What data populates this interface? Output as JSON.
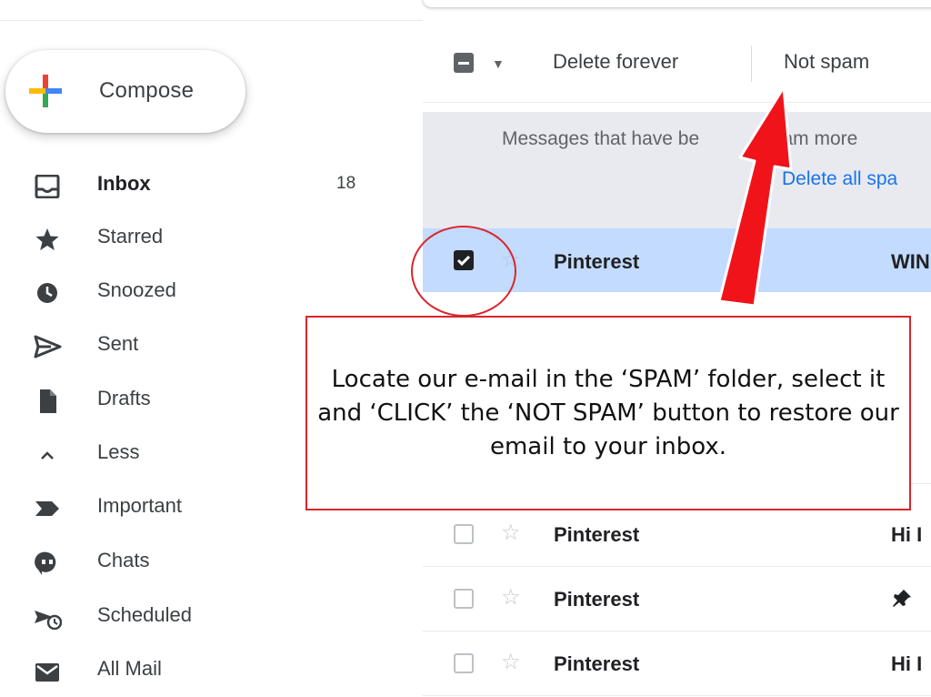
{
  "compose": {
    "label": "Compose",
    "icon": "compose-plus-icon"
  },
  "sidebar": {
    "items": [
      {
        "label": "Inbox",
        "count": "18",
        "icon": "inbox-icon",
        "active": true
      },
      {
        "label": "Starred",
        "count": "",
        "icon": "star-icon"
      },
      {
        "label": "Snoozed",
        "count": "",
        "icon": "clock-icon"
      },
      {
        "label": "Sent",
        "count": "",
        "icon": "send-icon"
      },
      {
        "label": "Drafts",
        "count": "",
        "icon": "draft-icon"
      },
      {
        "label": "Less",
        "count": "",
        "icon": "chevron-up-icon"
      },
      {
        "label": "Important",
        "count": "",
        "icon": "important-icon"
      },
      {
        "label": "Chats",
        "count": "",
        "icon": "chat-icon"
      },
      {
        "label": "Scheduled",
        "count": "",
        "icon": "scheduled-icon"
      },
      {
        "label": "All Mail",
        "count": "",
        "icon": "mail-icon"
      }
    ]
  },
  "toolbar": {
    "delete_forever": "Delete forever",
    "not_spam": "Not spam"
  },
  "banner": {
    "text": "Messages that have be",
    "text_tail": ", Spam more",
    "link": "Delete all spa"
  },
  "messages": [
    {
      "sender": "Pinterest",
      "subject": "WIN",
      "selected": true
    },
    {
      "sender": "Pinterest",
      "subject": "Hi I",
      "selected": false
    },
    {
      "sender": "Pinterest",
      "subject": "📌 ",
      "selected": false
    },
    {
      "sender": "Pinterest",
      "subject": "Hi I",
      "selected": false
    }
  ],
  "annotation": {
    "text": "Locate our e-mail in the ‘SPAM’ folder, select it and ‘CLICK’ the ‘NOT SPAM’ button to restore our email to your inbox."
  },
  "colors": {
    "annotation_red": "#d9262d",
    "selected_row": "#c2dbff",
    "link_blue": "#1a73e8",
    "banner_bg": "#e8eaf0"
  }
}
